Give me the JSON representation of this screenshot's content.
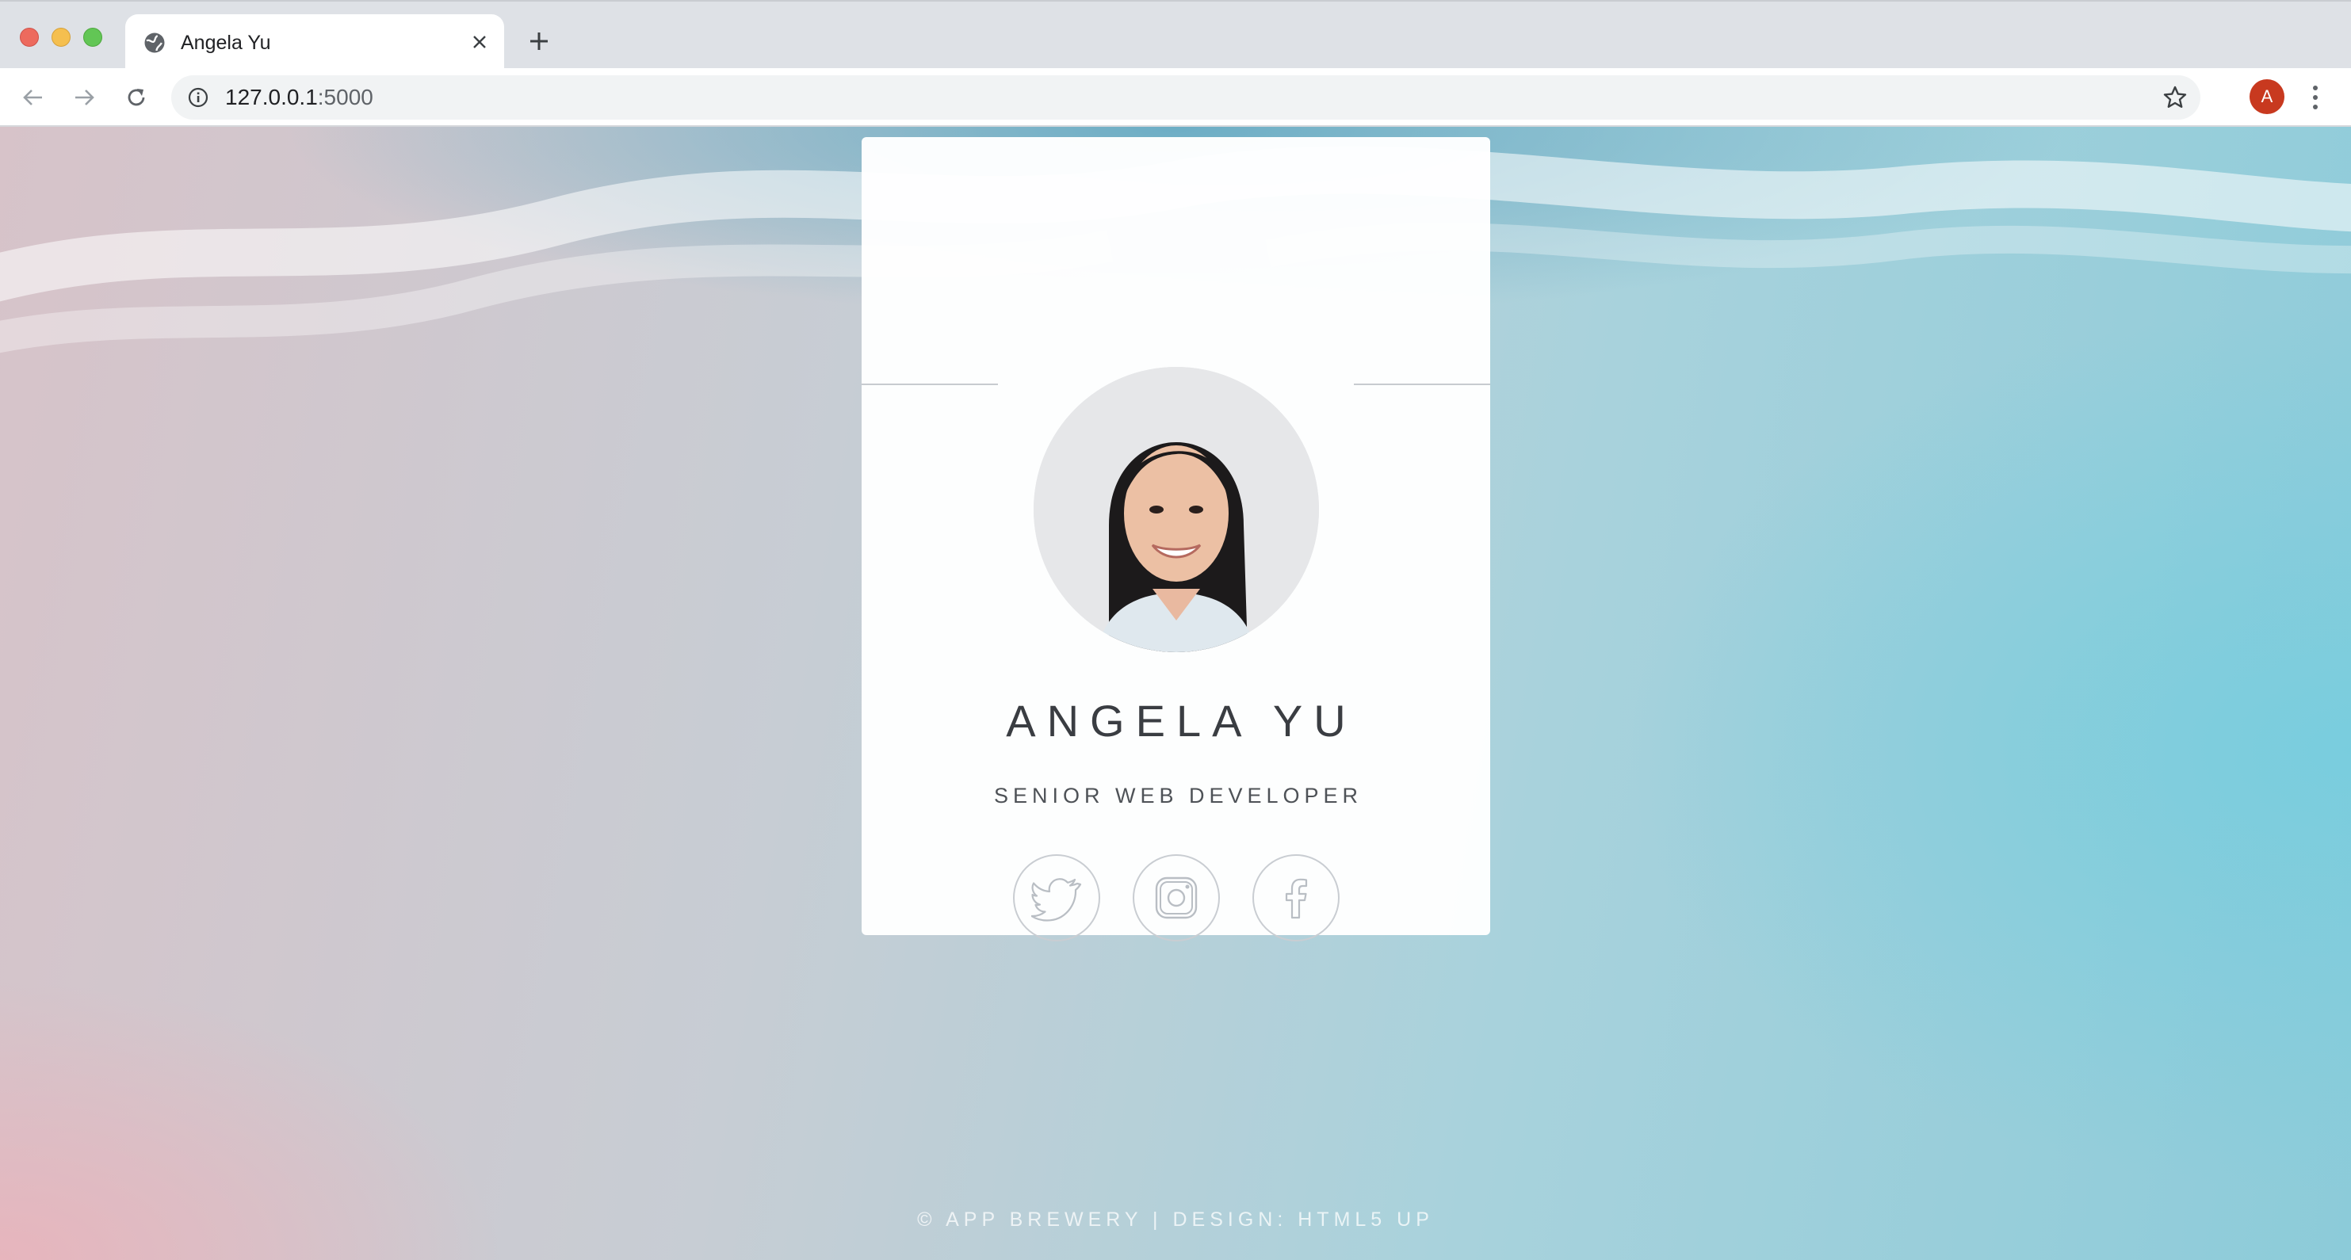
{
  "browser": {
    "tab_title": "Angela Yu",
    "url_host": "127.0.0.1",
    "url_port": ":5000",
    "profile_initial": "A"
  },
  "profile": {
    "name": "ANGELA YU",
    "role": "SENIOR WEB DEVELOPER",
    "social": [
      "twitter-icon",
      "instagram-icon",
      "facebook-icon"
    ]
  },
  "footer": {
    "text": "© APP BREWERY  |  DESIGN: HTML5 UP"
  },
  "colors": {
    "card_bg": "#ffffff",
    "text_dark": "#3a3d42",
    "avatar_red": "#c8391f"
  }
}
